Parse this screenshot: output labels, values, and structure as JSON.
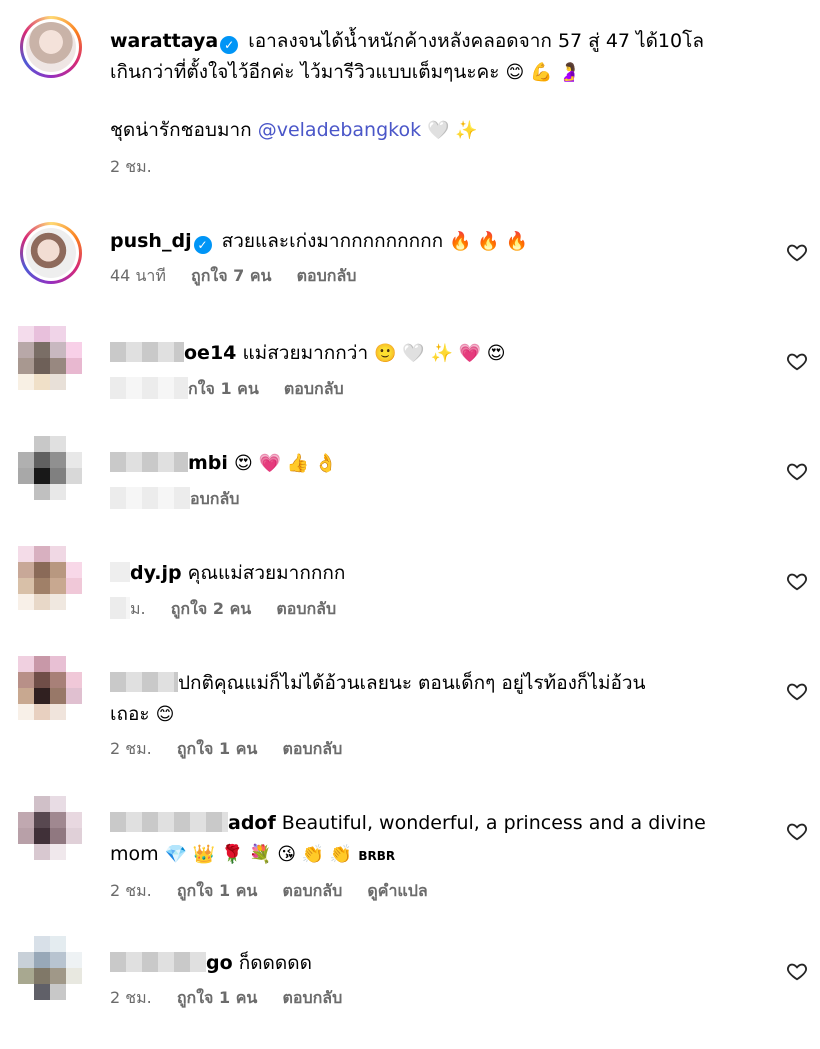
{
  "caption": {
    "username": "warattaya",
    "verified_glyph": "✓",
    "text_line": "เอาลงจนได้น้ำหนักค้างหลังคลอดจาก 57 สู่ 47 ได้10โล",
    "text_line2": "เกินกว่าที่ตั้งใจไว้อีกค่ะ ไว้มารีวิวแบบเต็มๆนะคะ",
    "emojis_line2": "😊 💪 🤰",
    "para2_text": "ชุดน่ารักชอบมาก",
    "mention": "@veladebangkok",
    "para2_emojis": "🤍 ✨",
    "time": "2 ชม."
  },
  "comments": [
    {
      "username": "push_dj",
      "verified_glyph": "✓",
      "text": "สวยและเก่งมากกกกกกกกก",
      "emojis": "🔥 🔥 🔥",
      "time": "44 นาที",
      "likes": "ถูกใจ 7 คน",
      "reply": "ตอบกลับ"
    },
    {
      "username_visible": "oe14",
      "text": "แม่สวยมากกว่า",
      "emojis": "🙂 🤍 ✨ 💗 😍",
      "likes": "กใจ 1 คน",
      "reply": "ตอบกลับ"
    },
    {
      "username_visible": "mbi",
      "text": "",
      "emojis": "😍 💗 👍 👌",
      "reply": "อบกลับ"
    },
    {
      "username_visible": "dy.jp",
      "text": "คุณแม่สวยมากกกก",
      "time": "ม.",
      "likes": "ถูกใจ 2 คน",
      "reply": "ตอบกลับ"
    },
    {
      "username_visible": "",
      "text": "ปกติคุณแม่ก็ไม่ได้อ้วนเลยนะ ตอนเด็กๆ อยู่ไรท้องก็ไม่อ้วน",
      "text_line2": "เถอะ",
      "emojis": "😊",
      "time": "2 ชม.",
      "likes": "ถูกใจ 1 คน",
      "reply": "ตอบกลับ"
    },
    {
      "username_visible": "adof",
      "text": "Beautiful, wonderful, a princess and a divine",
      "text_line2": "mom",
      "emojis": "💎 👑 🌹 💐 😘 👏 👏",
      "emoji_suffix": "BRBR",
      "time": "2 ชม.",
      "likes": "ถูกใจ 1 คน",
      "reply": "ตอบกลับ",
      "translate": "ดูคำแปล"
    },
    {
      "username_visible": "go",
      "text": "ก็ดดดดด",
      "time": "2 ชม.",
      "likes": "ถูกใจ 1 คน",
      "reply": "ตอบกลับ"
    }
  ],
  "icons": {
    "like": "heart-icon"
  },
  "colors": {
    "verified": "#0095f6",
    "mention": "#4a56c8",
    "meta": "#6b6b6b"
  }
}
